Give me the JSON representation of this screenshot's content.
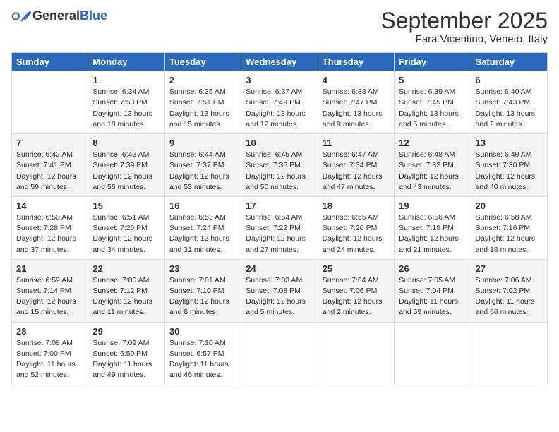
{
  "logo": {
    "general": "General",
    "blue": "Blue"
  },
  "header": {
    "month": "September 2025",
    "location": "Fara Vicentino, Veneto, Italy"
  },
  "weekdays": [
    "Sunday",
    "Monday",
    "Tuesday",
    "Wednesday",
    "Thursday",
    "Friday",
    "Saturday"
  ],
  "weeks": [
    [
      {
        "day": "",
        "sunrise": "",
        "sunset": "",
        "daylight": ""
      },
      {
        "day": "1",
        "sunrise": "Sunrise: 6:34 AM",
        "sunset": "Sunset: 7:53 PM",
        "daylight": "Daylight: 13 hours and 18 minutes."
      },
      {
        "day": "2",
        "sunrise": "Sunrise: 6:35 AM",
        "sunset": "Sunset: 7:51 PM",
        "daylight": "Daylight: 13 hours and 15 minutes."
      },
      {
        "day": "3",
        "sunrise": "Sunrise: 6:37 AM",
        "sunset": "Sunset: 7:49 PM",
        "daylight": "Daylight: 13 hours and 12 minutes."
      },
      {
        "day": "4",
        "sunrise": "Sunrise: 6:38 AM",
        "sunset": "Sunset: 7:47 PM",
        "daylight": "Daylight: 13 hours and 9 minutes."
      },
      {
        "day": "5",
        "sunrise": "Sunrise: 6:39 AM",
        "sunset": "Sunset: 7:45 PM",
        "daylight": "Daylight: 13 hours and 5 minutes."
      },
      {
        "day": "6",
        "sunrise": "Sunrise: 6:40 AM",
        "sunset": "Sunset: 7:43 PM",
        "daylight": "Daylight: 13 hours and 2 minutes."
      }
    ],
    [
      {
        "day": "7",
        "sunrise": "Sunrise: 6:42 AM",
        "sunset": "Sunset: 7:41 PM",
        "daylight": "Daylight: 12 hours and 59 minutes."
      },
      {
        "day": "8",
        "sunrise": "Sunrise: 6:43 AM",
        "sunset": "Sunset: 7:39 PM",
        "daylight": "Daylight: 12 hours and 56 minutes."
      },
      {
        "day": "9",
        "sunrise": "Sunrise: 6:44 AM",
        "sunset": "Sunset: 7:37 PM",
        "daylight": "Daylight: 12 hours and 53 minutes."
      },
      {
        "day": "10",
        "sunrise": "Sunrise: 6:45 AM",
        "sunset": "Sunset: 7:35 PM",
        "daylight": "Daylight: 12 hours and 50 minutes."
      },
      {
        "day": "11",
        "sunrise": "Sunrise: 6:47 AM",
        "sunset": "Sunset: 7:34 PM",
        "daylight": "Daylight: 12 hours and 47 minutes."
      },
      {
        "day": "12",
        "sunrise": "Sunrise: 6:48 AM",
        "sunset": "Sunset: 7:32 PM",
        "daylight": "Daylight: 12 hours and 43 minutes."
      },
      {
        "day": "13",
        "sunrise": "Sunrise: 6:49 AM",
        "sunset": "Sunset: 7:30 PM",
        "daylight": "Daylight: 12 hours and 40 minutes."
      }
    ],
    [
      {
        "day": "14",
        "sunrise": "Sunrise: 6:50 AM",
        "sunset": "Sunset: 7:28 PM",
        "daylight": "Daylight: 12 hours and 37 minutes."
      },
      {
        "day": "15",
        "sunrise": "Sunrise: 6:51 AM",
        "sunset": "Sunset: 7:26 PM",
        "daylight": "Daylight: 12 hours and 34 minutes."
      },
      {
        "day": "16",
        "sunrise": "Sunrise: 6:53 AM",
        "sunset": "Sunset: 7:24 PM",
        "daylight": "Daylight: 12 hours and 31 minutes."
      },
      {
        "day": "17",
        "sunrise": "Sunrise: 6:54 AM",
        "sunset": "Sunset: 7:22 PM",
        "daylight": "Daylight: 12 hours and 27 minutes."
      },
      {
        "day": "18",
        "sunrise": "Sunrise: 6:55 AM",
        "sunset": "Sunset: 7:20 PM",
        "daylight": "Daylight: 12 hours and 24 minutes."
      },
      {
        "day": "19",
        "sunrise": "Sunrise: 6:56 AM",
        "sunset": "Sunset: 7:18 PM",
        "daylight": "Daylight: 12 hours and 21 minutes."
      },
      {
        "day": "20",
        "sunrise": "Sunrise: 6:58 AM",
        "sunset": "Sunset: 7:16 PM",
        "daylight": "Daylight: 12 hours and 18 minutes."
      }
    ],
    [
      {
        "day": "21",
        "sunrise": "Sunrise: 6:59 AM",
        "sunset": "Sunset: 7:14 PM",
        "daylight": "Daylight: 12 hours and 15 minutes."
      },
      {
        "day": "22",
        "sunrise": "Sunrise: 7:00 AM",
        "sunset": "Sunset: 7:12 PM",
        "daylight": "Daylight: 12 hours and 11 minutes."
      },
      {
        "day": "23",
        "sunrise": "Sunrise: 7:01 AM",
        "sunset": "Sunset: 7:10 PM",
        "daylight": "Daylight: 12 hours and 8 minutes."
      },
      {
        "day": "24",
        "sunrise": "Sunrise: 7:03 AM",
        "sunset": "Sunset: 7:08 PM",
        "daylight": "Daylight: 12 hours and 5 minutes."
      },
      {
        "day": "25",
        "sunrise": "Sunrise: 7:04 AM",
        "sunset": "Sunset: 7:06 PM",
        "daylight": "Daylight: 12 hours and 2 minutes."
      },
      {
        "day": "26",
        "sunrise": "Sunrise: 7:05 AM",
        "sunset": "Sunset: 7:04 PM",
        "daylight": "Daylight: 11 hours and 59 minutes."
      },
      {
        "day": "27",
        "sunrise": "Sunrise: 7:06 AM",
        "sunset": "Sunset: 7:02 PM",
        "daylight": "Daylight: 11 hours and 56 minutes."
      }
    ],
    [
      {
        "day": "28",
        "sunrise": "Sunrise: 7:08 AM",
        "sunset": "Sunset: 7:00 PM",
        "daylight": "Daylight: 11 hours and 52 minutes."
      },
      {
        "day": "29",
        "sunrise": "Sunrise: 7:09 AM",
        "sunset": "Sunset: 6:59 PM",
        "daylight": "Daylight: 11 hours and 49 minutes."
      },
      {
        "day": "30",
        "sunrise": "Sunrise: 7:10 AM",
        "sunset": "Sunset: 6:57 PM",
        "daylight": "Daylight: 11 hours and 46 minutes."
      },
      {
        "day": "",
        "sunrise": "",
        "sunset": "",
        "daylight": ""
      },
      {
        "day": "",
        "sunrise": "",
        "sunset": "",
        "daylight": ""
      },
      {
        "day": "",
        "sunrise": "",
        "sunset": "",
        "daylight": ""
      },
      {
        "day": "",
        "sunrise": "",
        "sunset": "",
        "daylight": ""
      }
    ]
  ]
}
